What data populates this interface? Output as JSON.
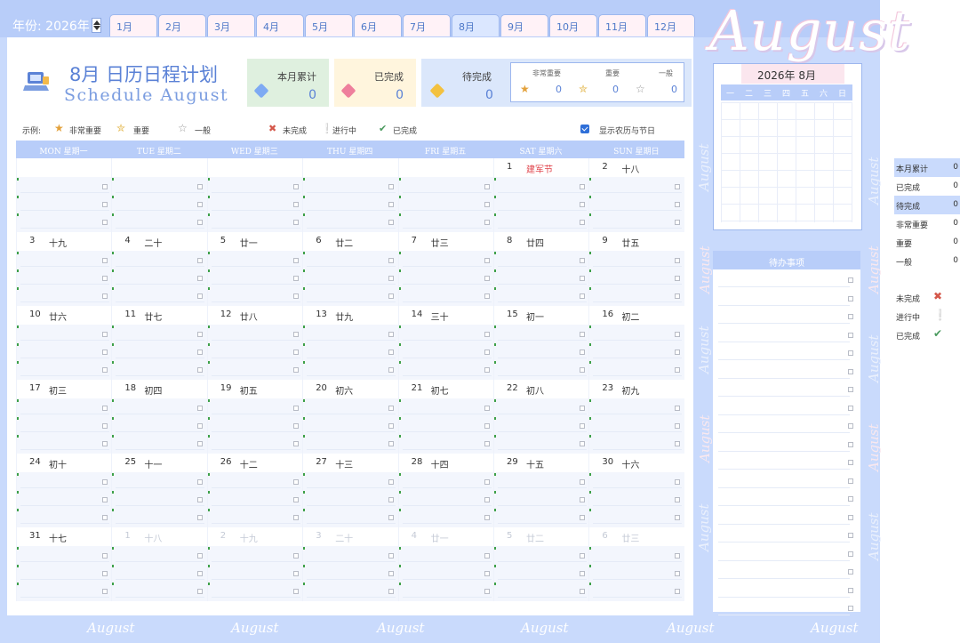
{
  "header": {
    "year_label": "年份: 2026年",
    "months": [
      "1月",
      "2月",
      "3月",
      "4月",
      "5月",
      "6月",
      "7月",
      "8月",
      "9月",
      "10月",
      "11月",
      "12月"
    ],
    "active_month_index": 7,
    "big_title": "August"
  },
  "title": {
    "cn": "8月 日历日程计划",
    "en": "Schedule  August"
  },
  "stats": {
    "total_label": "本月累计",
    "total_value": "0",
    "done_label": "已完成",
    "done_value": "0",
    "todo_label": "待完成",
    "todo_value": "0",
    "priorities": [
      {
        "label": "非常重要",
        "value": "0"
      },
      {
        "label": "重要",
        "value": "0"
      },
      {
        "label": "一般",
        "value": "0"
      }
    ]
  },
  "legend": {
    "prefix": "示例:",
    "very_important": "非常重要",
    "important": "重要",
    "normal": "一般",
    "not_done": "未完成",
    "in_progress": "进行中",
    "done": "已完成",
    "lunar_toggle": "显示农历与节日"
  },
  "weekdays": [
    "MON 星期一",
    "TUE 星期二",
    "WED 星期三",
    "THU 星期四",
    "FRI 星期五",
    "SAT 星期六",
    "SUN 星期日"
  ],
  "weeks": [
    [
      {
        "n": "",
        "l": ""
      },
      {
        "n": "",
        "l": ""
      },
      {
        "n": "",
        "l": ""
      },
      {
        "n": "",
        "l": ""
      },
      {
        "n": "",
        "l": ""
      },
      {
        "n": "1",
        "l": "建军节",
        "f": true
      },
      {
        "n": "2",
        "l": "十八"
      }
    ],
    [
      {
        "n": "3",
        "l": "十九"
      },
      {
        "n": "4",
        "l": "二十"
      },
      {
        "n": "5",
        "l": "廿一"
      },
      {
        "n": "6",
        "l": "廿二"
      },
      {
        "n": "7",
        "l": "廿三"
      },
      {
        "n": "8",
        "l": "廿四"
      },
      {
        "n": "9",
        "l": "廿五"
      }
    ],
    [
      {
        "n": "10",
        "l": "廿六"
      },
      {
        "n": "11",
        "l": "廿七"
      },
      {
        "n": "12",
        "l": "廿八"
      },
      {
        "n": "13",
        "l": "廿九"
      },
      {
        "n": "14",
        "l": "三十"
      },
      {
        "n": "15",
        "l": "初一"
      },
      {
        "n": "16",
        "l": "初二"
      }
    ],
    [
      {
        "n": "17",
        "l": "初三"
      },
      {
        "n": "18",
        "l": "初四"
      },
      {
        "n": "19",
        "l": "初五"
      },
      {
        "n": "20",
        "l": "初六"
      },
      {
        "n": "21",
        "l": "初七"
      },
      {
        "n": "22",
        "l": "初八"
      },
      {
        "n": "23",
        "l": "初九"
      }
    ],
    [
      {
        "n": "24",
        "l": "初十"
      },
      {
        "n": "25",
        "l": "十一"
      },
      {
        "n": "26",
        "l": "十二"
      },
      {
        "n": "27",
        "l": "十三"
      },
      {
        "n": "28",
        "l": "十四"
      },
      {
        "n": "29",
        "l": "十五"
      },
      {
        "n": "30",
        "l": "十六"
      }
    ],
    [
      {
        "n": "31",
        "l": "十七"
      },
      {
        "n": "1",
        "l": "十八",
        "o": true
      },
      {
        "n": "2",
        "l": "十九",
        "o": true
      },
      {
        "n": "3",
        "l": "二十",
        "o": true
      },
      {
        "n": "4",
        "l": "廿一",
        "o": true
      },
      {
        "n": "5",
        "l": "廿二",
        "o": true
      },
      {
        "n": "6",
        "l": "廿三",
        "o": true
      }
    ]
  ],
  "mini_calendar": {
    "header": "2026年    8月",
    "weekdays": [
      "一",
      "二",
      "三",
      "四",
      "五",
      "六",
      "日"
    ]
  },
  "todo": {
    "header": "待办事项"
  },
  "summary": [
    {
      "label": "本月累计",
      "value": "0"
    },
    {
      "label": "已完成",
      "value": "0"
    },
    {
      "label": "待完成",
      "value": "0"
    },
    {
      "label": "非常重要",
      "value": "0"
    },
    {
      "label": "重要",
      "value": "0"
    },
    {
      "label": "一般",
      "value": "0"
    }
  ],
  "status_legend": [
    {
      "label": "未完成",
      "icon": "cross-icon",
      "color": "#d4574a"
    },
    {
      "label": "进行中",
      "icon": "exclamation-icon",
      "color": "#e3b64a"
    },
    {
      "label": "已完成",
      "icon": "check-icon",
      "color": "#4a9a5e"
    }
  ],
  "watermark": "August",
  "colors": {
    "accent": "#b8cdf9",
    "title": "#5b82d6",
    "festival": "#e0434b"
  }
}
